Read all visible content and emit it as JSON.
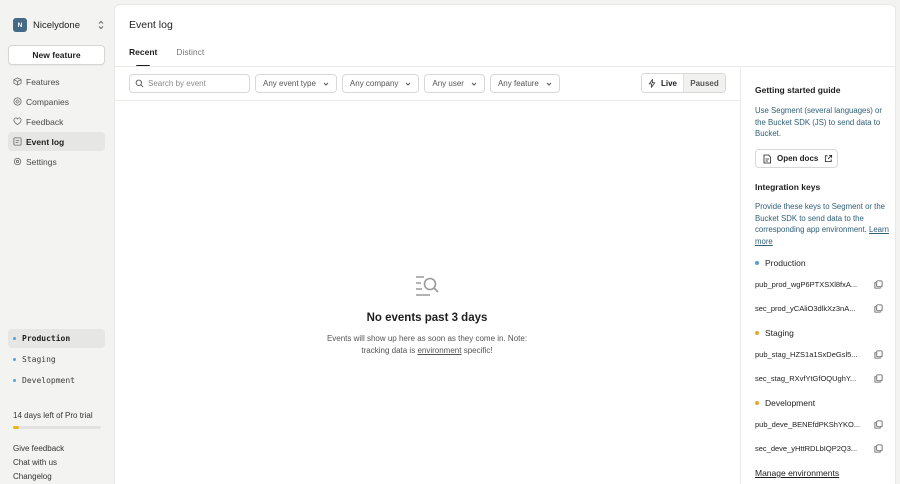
{
  "org": {
    "initial": "N",
    "name": "Nicelydone"
  },
  "sidebar": {
    "new_feature_label": "New feature",
    "nav": [
      {
        "label": "Features",
        "icon": "feature-icon",
        "active": false
      },
      {
        "label": "Companies",
        "icon": "companies-icon",
        "active": false
      },
      {
        "label": "Feedback",
        "icon": "feedback-icon",
        "active": false
      },
      {
        "label": "Event log",
        "icon": "event-log-icon",
        "active": true
      },
      {
        "label": "Settings",
        "icon": "settings-icon",
        "active": false
      }
    ],
    "environments": [
      {
        "label": "Production",
        "active": true
      },
      {
        "label": "Staging",
        "active": false
      },
      {
        "label": "Development",
        "active": false
      }
    ],
    "trial_text": "14 days left of Pro trial",
    "trial_progress": 0.07,
    "footer_links": [
      "Give feedback",
      "Chat with us",
      "Changelog"
    ]
  },
  "main": {
    "title": "Event log",
    "tabs": [
      {
        "label": "Recent",
        "active": true
      },
      {
        "label": "Distinct",
        "active": false
      }
    ],
    "search_placeholder": "Search by event",
    "filters": [
      "Any event type",
      "Any company",
      "Any user",
      "Any feature"
    ],
    "live_label": "Live",
    "paused_label": "Paused",
    "empty": {
      "title": "No events past 3 days",
      "desc_before": "Events will show up here as soon as they come in. Note: tracking data is ",
      "desc_link": "environment",
      "desc_after": " specific!"
    }
  },
  "guide": {
    "title": "Getting started guide",
    "intro": "Use Segment (several languages) or the Bucket SDK (JS) to send data to Bucket.",
    "open_docs_label": "Open docs",
    "keys_title": "Integration keys",
    "keys_desc": "Provide these keys to Segment or the Bucket SDK to send data to the corresponding app environment.",
    "learn_more": "Learn more",
    "environments": [
      {
        "name": "Production",
        "pub": "pub_prod_wgP6PTXSXl8fxA...",
        "sec": "sec_prod_yCAliO3dlkXz3nA..."
      },
      {
        "name": "Staging",
        "pub": "pub_stag_HZS1a1SxDeGsl5...",
        "sec": "sec_stag_RXvfYtGfOQUghY..."
      },
      {
        "name": "Development",
        "pub": "pub_deve_BENEfdPKShYKO...",
        "sec": "sec_deve_yHttRDLbIQP2Q3..."
      }
    ],
    "manage_label": "Manage environments"
  },
  "colors": {
    "env_dot": "#e8a92a",
    "production_dot": "#5a9fd4",
    "trial_fill": "#e8b61f",
    "avatar_bg": "#456a86",
    "guide_text": "#2f5f77"
  }
}
